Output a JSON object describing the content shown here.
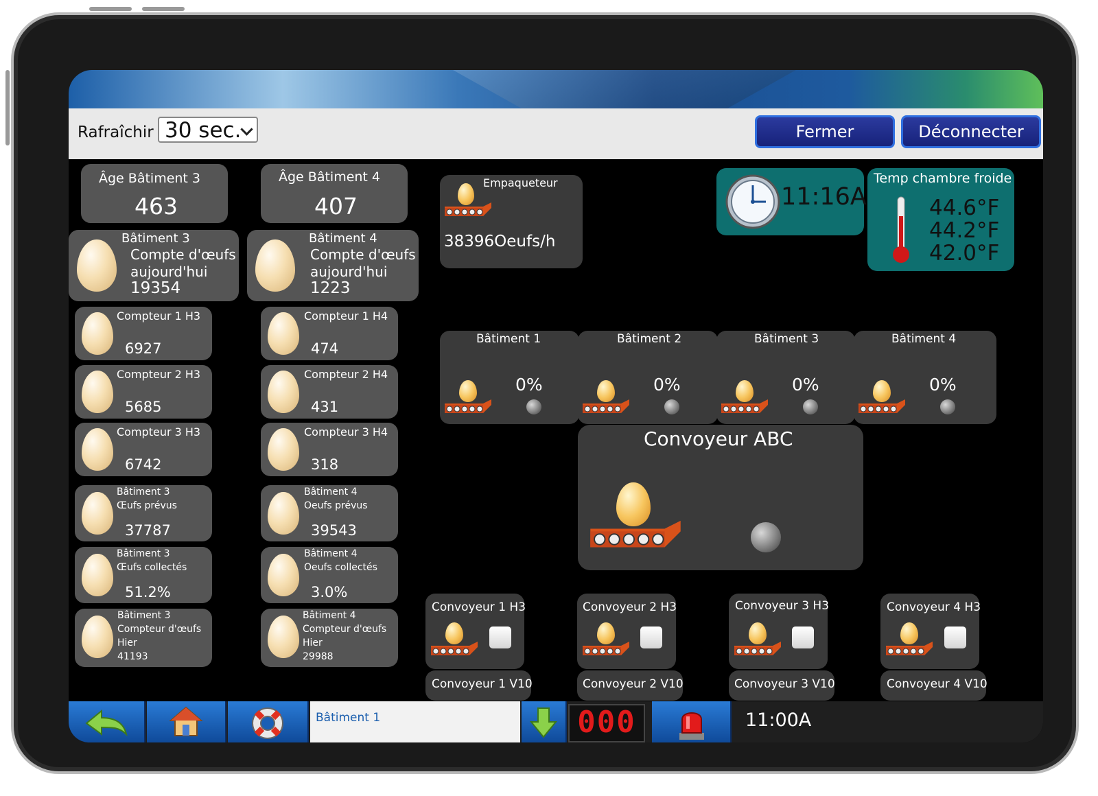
{
  "toolbar": {
    "refresh_label": "Rafraîchir",
    "refresh_value": "30 sec.",
    "close_label": "Fermer",
    "logout_label": "Déconnecter"
  },
  "ages": [
    {
      "title": "Âge Bâtiment 3",
      "value": "463"
    },
    {
      "title": "Âge Bâtiment 4",
      "value": "407"
    }
  ],
  "counts_today": [
    {
      "line1": "Bâtiment 3",
      "line2": "Compte d'œufs",
      "line3": "aujourd'hui",
      "value": "19354"
    },
    {
      "line1": "Bâtiment 4",
      "line2": "Compte d'œufs",
      "line3": "aujourd'hui",
      "value": "1223"
    }
  ],
  "counters_h3": [
    {
      "label": "Compteur 1 H3",
      "value": "6927"
    },
    {
      "label": "Compteur 2 H3",
      "value": "5685"
    },
    {
      "label": "Compteur 3 H3",
      "value": "6742"
    }
  ],
  "counters_h4": [
    {
      "label": "Compteur 1 H4",
      "value": "474"
    },
    {
      "label": "Compteur 2 H4",
      "value": "431"
    },
    {
      "label": "Compteur 3 H4",
      "value": "318"
    }
  ],
  "stats_h3": [
    {
      "line1": "Bâtiment 3",
      "line2": "Œufs prévus",
      "value": "37787"
    },
    {
      "line1": "Bâtiment 3",
      "line2": "Œufs collectés",
      "value": "51.2%"
    },
    {
      "line1": "Bâtiment 3",
      "line2": "Compteur d'œufs",
      "line3": "Hier",
      "value": "41193"
    }
  ],
  "stats_h4": [
    {
      "line1": "Bâtiment 4",
      "line2": "Oeufs prévus",
      "value": "39543"
    },
    {
      "line1": "Bâtiment 4",
      "line2": "Oeufs collectés",
      "value": "3.0%"
    },
    {
      "line1": "Bâtiment 4",
      "line2": "Compteur d'œufs",
      "line3": "Hier",
      "value": "29988"
    }
  ],
  "packer": {
    "title": "Empaqueteur",
    "value": "38396Oeufs/h"
  },
  "clock": {
    "time": "11:16A"
  },
  "cold_room": {
    "title": "Temp chambre froide",
    "temps": [
      "44.6°F",
      "44.2°F",
      "42.0°F"
    ]
  },
  "buildings": [
    {
      "title": "Bâtiment 1",
      "percent": "0%"
    },
    {
      "title": "Bâtiment 2",
      "percent": "0%"
    },
    {
      "title": "Bâtiment 3",
      "percent": "0%"
    },
    {
      "title": "Bâtiment 4",
      "percent": "0%"
    }
  ],
  "main_conveyor": {
    "title": "Convoyeur ABC"
  },
  "conveyors": [
    {
      "title": "Convoyeur 1 H3",
      "sub": "Convoyeur 1 V10"
    },
    {
      "title": "Convoyeur 2 H3",
      "sub": "Convoyeur 2 V10"
    },
    {
      "title": "Convoyeur 3 H3",
      "sub": "Convoyeur 3 V10"
    },
    {
      "title": "Convoyeur 4 H3",
      "sub": "Convoyeur 4 V10"
    }
  ],
  "bottom": {
    "status_text": "Bâtiment 1",
    "counter": "000",
    "time": "11:00A"
  },
  "colors": {
    "accent": "#1b2a8c",
    "teal": "#0e6f6f",
    "panel": "#555555",
    "alarm": "#e21b1b"
  }
}
